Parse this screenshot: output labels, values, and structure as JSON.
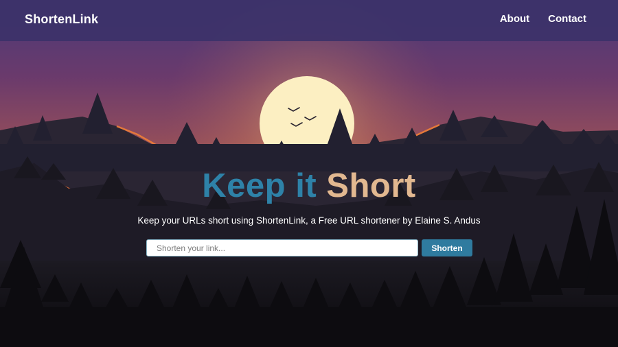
{
  "navbar": {
    "brand": "ShortenLink",
    "links": [
      {
        "label": "About"
      },
      {
        "label": "Contact"
      }
    ]
  },
  "hero": {
    "title_part1": "Keep it",
    "title_part2": "Short",
    "tagline": "Keep your URLs short using ShortenLink, a Free URL shortener by Elaine S. Andus"
  },
  "shorten_form": {
    "placeholder": "Shorten your link...",
    "button_label": "Shorten"
  },
  "colors": {
    "navbar_bg": "#3c3269",
    "title_accent_blue": "#2e82a8",
    "title_accent_sand": "#e2b890",
    "button_bg": "#2f7b9f"
  }
}
